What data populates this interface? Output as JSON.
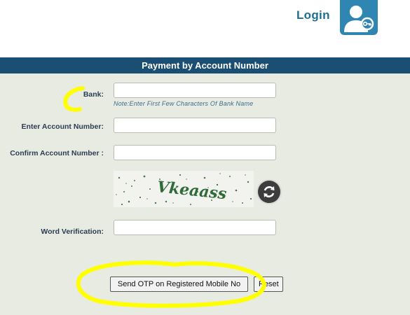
{
  "header": {
    "login_label": "Login"
  },
  "form": {
    "title": "Payment by Account Number",
    "bank_label": "Bank:",
    "bank_note": "Note:Enter First Few Characters Of Bank Name",
    "account_label": "Enter Account Number:",
    "confirm_label": "Confirm Account Number :",
    "word_label": "Word Verification:",
    "captcha_text": "Vkeaass"
  },
  "buttons": {
    "send_otp": "Send OTP on Registered Mobile No",
    "reset": "Reset"
  },
  "colors": {
    "header_bar": "#1b4e73",
    "panel_bg": "#e8ebe1",
    "login_text": "#1f6e92",
    "highlight": "#ffff00"
  }
}
